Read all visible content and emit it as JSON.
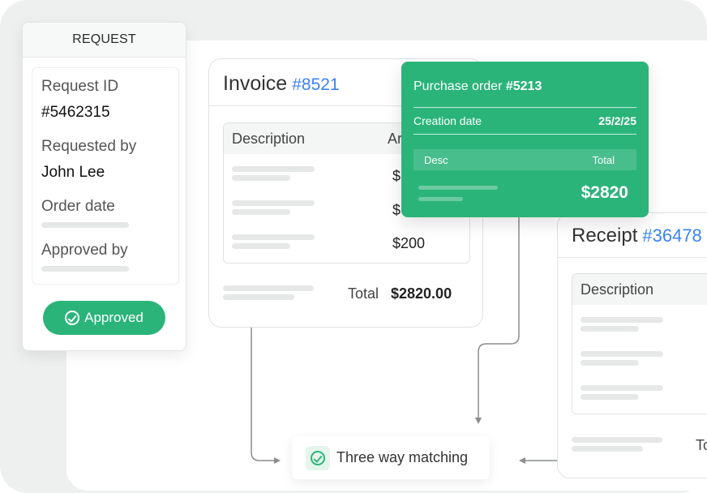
{
  "request": {
    "header": "REQUEST",
    "request_id_label": "Request ID",
    "request_id_value": "#5462315",
    "requested_by_label": "Requested by",
    "requested_by_value": "John Lee",
    "order_date_label": "Order date",
    "approved_by_label": "Approved by",
    "approved_button": "Approved"
  },
  "invoice": {
    "title": "Invoice",
    "number": "#8521",
    "col_description": "Description",
    "col_amount": "Ar",
    "amounts": [
      "$",
      "$",
      "$200"
    ],
    "total_label": "Total",
    "total_value": "$2820.00"
  },
  "purchase_order": {
    "title_prefix": "Purchase order",
    "number": "#5213",
    "creation_date_label": "Creation date",
    "creation_date_value": "25/2/25",
    "col_desc": "Desc",
    "col_total": "Total",
    "total_value": "$2820"
  },
  "receipt": {
    "title": "Receipt",
    "number": "#36478",
    "col_description": "Description",
    "total_partial": "To"
  },
  "matching": {
    "label": "Three way matching"
  },
  "colors": {
    "accent_green": "#2bb47a",
    "link_blue": "#3b82f6"
  }
}
